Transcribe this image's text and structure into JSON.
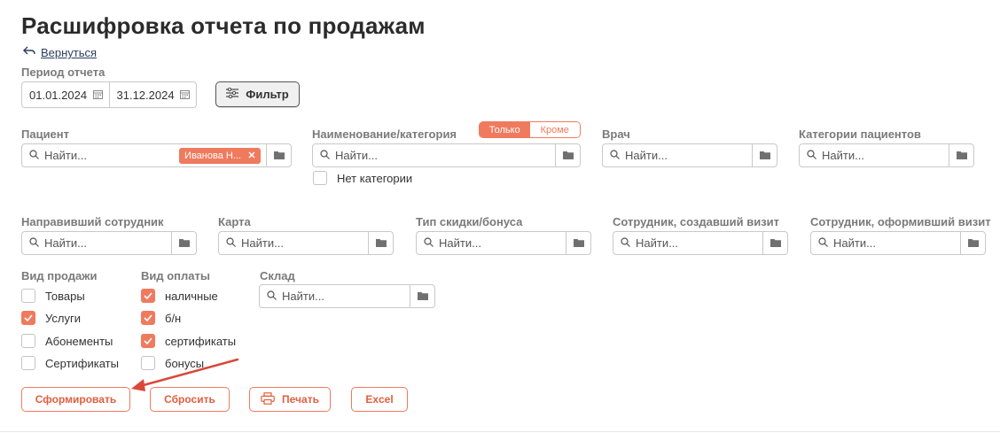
{
  "page": {
    "title": "Расшифровка отчета по продажам",
    "back_label": "Вернуться"
  },
  "period": {
    "label": "Период отчета",
    "from": "01.01.2024",
    "to": "31.12.2024"
  },
  "filter_button": {
    "label": "Фильтр"
  },
  "fields": {
    "patient": {
      "label": "Пациент",
      "placeholder": "Найти...",
      "chip": "Иванова Н..."
    },
    "category": {
      "label": "Наименование/категория",
      "placeholder": "Найти...",
      "toggle_on": "Только",
      "toggle_off": "Кроме",
      "no_category": "Нет категории"
    },
    "doctor": {
      "label": "Врач",
      "placeholder": "Найти..."
    },
    "patient_categories": {
      "label": "Категории пациентов",
      "placeholder": "Найти..."
    },
    "referrer": {
      "label": "Направивший сотрудник",
      "placeholder": "Найти..."
    },
    "card": {
      "label": "Карта",
      "placeholder": "Найти..."
    },
    "discount_type": {
      "label": "Тип скидки/бонуса",
      "placeholder": "Найти..."
    },
    "visit_creator": {
      "label": "Сотрудник, создавший визит",
      "placeholder": "Найти..."
    },
    "visit_issuer": {
      "label": "Сотрудник, оформивший визит",
      "placeholder": "Найти..."
    },
    "warehouse": {
      "label": "Склад",
      "placeholder": "Найти..."
    }
  },
  "sale_type": {
    "label": "Вид продажи",
    "items": [
      {
        "label": "Товары",
        "checked": false
      },
      {
        "label": "Услуги",
        "checked": true
      },
      {
        "label": "Абонементы",
        "checked": false
      },
      {
        "label": "Сертификаты",
        "checked": false
      }
    ]
  },
  "payment_type": {
    "label": "Вид оплаты",
    "items": [
      {
        "label": "наличные",
        "checked": true
      },
      {
        "label": "б/н",
        "checked": true
      },
      {
        "label": "сертификаты",
        "checked": true
      },
      {
        "label": "бонусы",
        "checked": false
      }
    ]
  },
  "actions": {
    "generate": "Сформировать",
    "reset": "Сбросить",
    "print": "Печать",
    "excel": "Excel"
  },
  "colors": {
    "accent": "#f07a5e",
    "annotation_arrow": "#d9483b"
  }
}
